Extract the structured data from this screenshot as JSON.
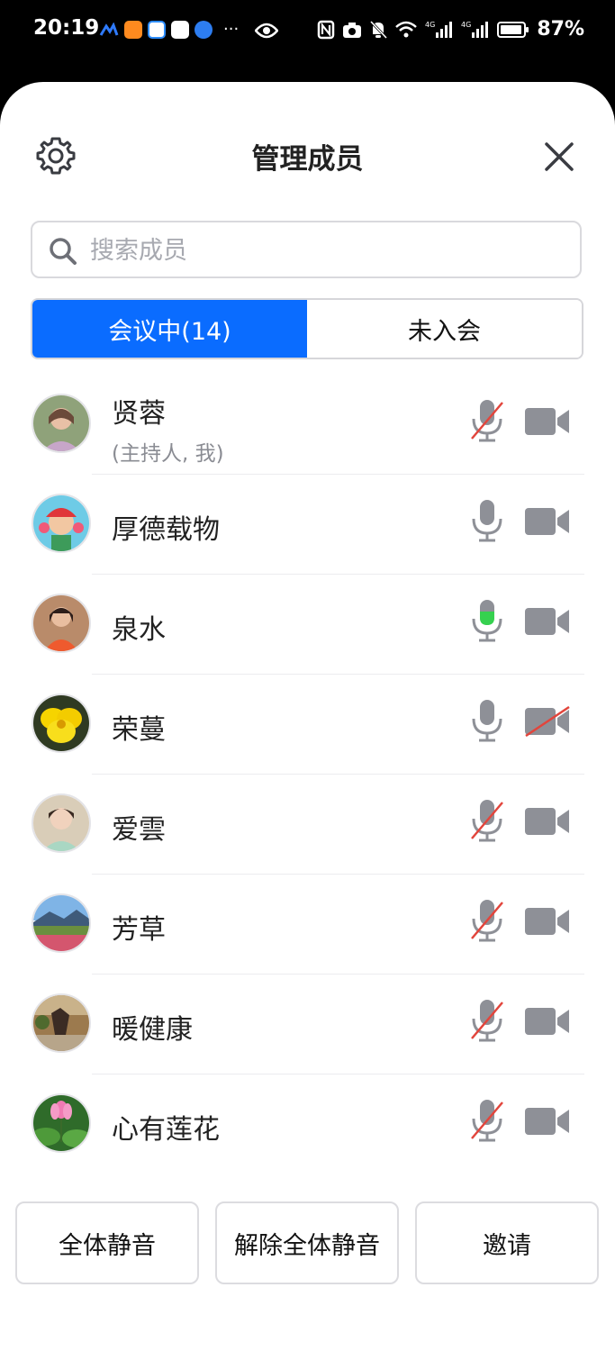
{
  "status_bar": {
    "time": "20:19",
    "battery": "87%",
    "network_1": "4G",
    "network_2": "4G"
  },
  "header": {
    "title": "管理成员",
    "settings_icon": "gear-icon",
    "close_icon": "close-icon"
  },
  "search": {
    "placeholder": "搜索成员",
    "value": ""
  },
  "tabs": [
    {
      "label": "会议中(14)",
      "active": true
    },
    {
      "label": "未入会",
      "active": false
    }
  ],
  "members": [
    {
      "name": "贤蓉",
      "role": "(主持人, 我)",
      "mic": "muted",
      "camera": "off"
    },
    {
      "name": "厚德载物",
      "role": "",
      "mic": "on",
      "camera": "off"
    },
    {
      "name": "泉水",
      "role": "",
      "mic": "speaking",
      "camera": "off"
    },
    {
      "name": "荣蔓",
      "role": "",
      "mic": "on",
      "camera": "disabled"
    },
    {
      "name": "爱雲",
      "role": "",
      "mic": "muted",
      "camera": "off"
    },
    {
      "name": "芳草",
      "role": "",
      "mic": "muted",
      "camera": "off"
    },
    {
      "name": "暖健康",
      "role": "",
      "mic": "muted",
      "camera": "off"
    },
    {
      "name": "心有莲花",
      "role": "",
      "mic": "muted",
      "camera": "off"
    }
  ],
  "actions": {
    "mute_all": "全体静音",
    "unmute_all": "解除全体静音",
    "invite": "邀请"
  },
  "colors": {
    "accent": "#0a6cff",
    "icon_gray": "#8e9097",
    "muted_red": "#e2453c",
    "speaking_green": "#36d14f"
  }
}
